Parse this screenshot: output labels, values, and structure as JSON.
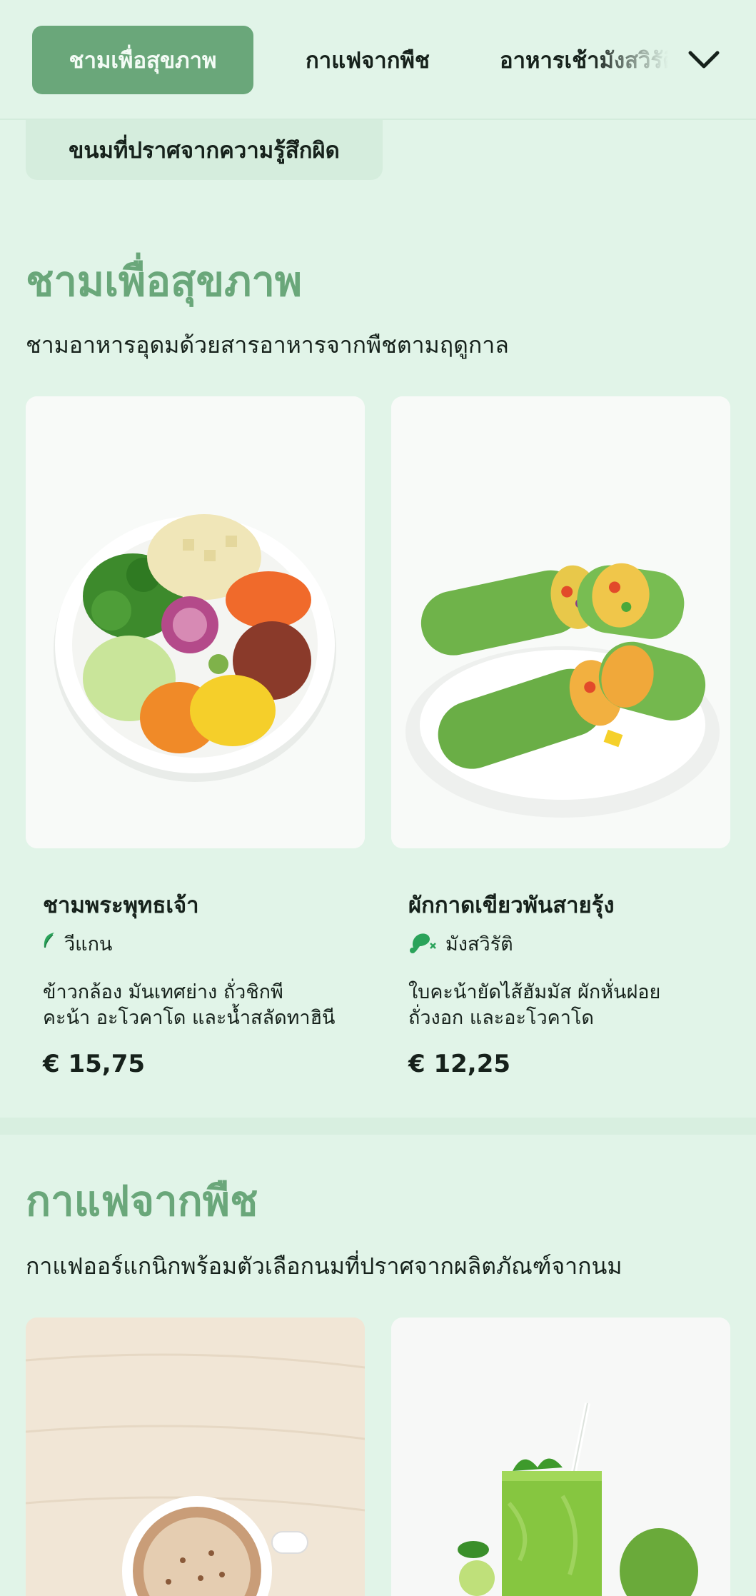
{
  "tabs": {
    "active": "ชามเพื่อสุขภาพ",
    "second": "กาแฟจากพืช",
    "third": "อาหารเช้ามังสวิรัติ",
    "overflow": "ขนมที่ปราศจากความรู้สึกผิด"
  },
  "sections": [
    {
      "title": "ชามเพื่อสุขภาพ",
      "subtitle": "ชามอาหารอุดมด้วยสารอาหารจากพืชตามฤดูกาล",
      "items": [
        {
          "name": "ชามพระพุทธเจ้า",
          "tag": "วีแกน",
          "tag_icon": "leaf-icon",
          "desc_line1": "ข้าวกล้อง มันเทศย่าง ถั่วชิกพี",
          "desc_line2": "คะน้า อะโวคาโด และน้ำสลัดทาฮินี",
          "price": "€ 15,75",
          "image": "buddha-bowl-image"
        },
        {
          "name": "ผักกาดเขียวพันสายรุ้ง",
          "tag": "มังสวิรัติ",
          "tag_icon": "no-meat-icon",
          "desc_line1": "ใบคะน้ายัดไส้ฮัมมัส ผักหั่นฝอย",
          "desc_line2": "ถั่วงอก และอะโวคาโด",
          "price": "€ 12,25",
          "image": "green-wrap-image"
        }
      ]
    },
    {
      "title": "กาแฟจากพืช",
      "subtitle": "กาแฟออร์แกนิกพร้อมตัวเลือกนมที่ปราศจากผลิตภัณฑ์จากนม",
      "items": [
        {
          "image": "latte-image"
        },
        {
          "image": "green-smoothie-image"
        }
      ]
    }
  ],
  "colors": {
    "background": "#e1f4e8",
    "accent": "#6aa77a",
    "text": "#16211b",
    "vegan_icon": "#2aa35a"
  }
}
